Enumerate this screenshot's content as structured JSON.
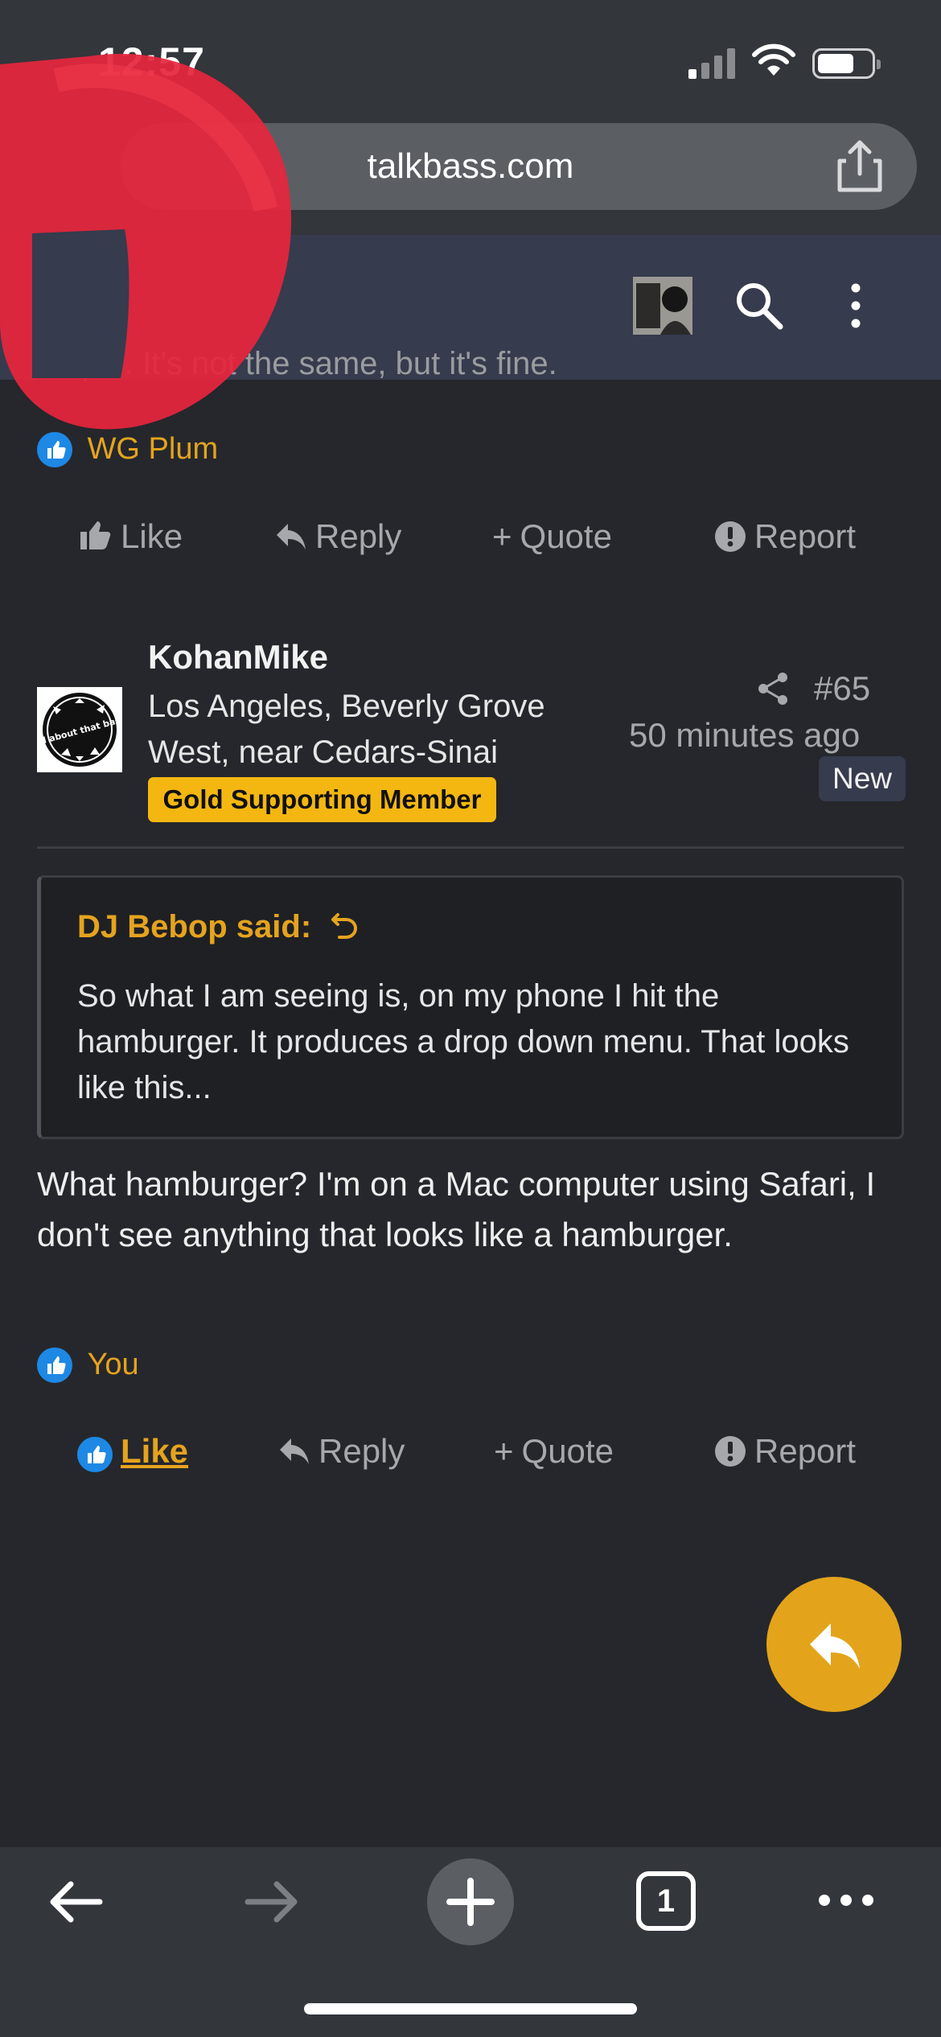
{
  "status_bar": {
    "time": "12:57"
  },
  "browser": {
    "url": "talkbass.com",
    "tab_count": "1"
  },
  "previous_post": {
    "cut_off_text": "...ople. It's not the same, but it's fine.",
    "reaction_user": "WG Plum"
  },
  "actions": {
    "like": "Like",
    "reply": "Reply",
    "quote": "Quote",
    "report": "Report"
  },
  "post": {
    "username": "KohanMike",
    "location": "Los Angeles, Beverly Grove West, near Cedars-Sinai",
    "badge": "Gold Supporting Member",
    "number": "#65",
    "time": "50 minutes ago",
    "new_label": "New",
    "avatar_text": "all about that bass",
    "quote": {
      "author": "DJ Bebop said:",
      "text": "So what I am seeing is, on my phone I hit the hamburger. It produces a drop down menu. That looks like this..."
    },
    "body": "What hamburger? I'm on a Mac computer using Safari, I don't see anything that looks like a hamburger.",
    "reaction_user": "You"
  },
  "colors": {
    "accent": "#e5a31e",
    "background": "#25272c",
    "nav": "#363b4d",
    "badge_gold": "#f4b711",
    "like_blue": "#1e88e5"
  }
}
